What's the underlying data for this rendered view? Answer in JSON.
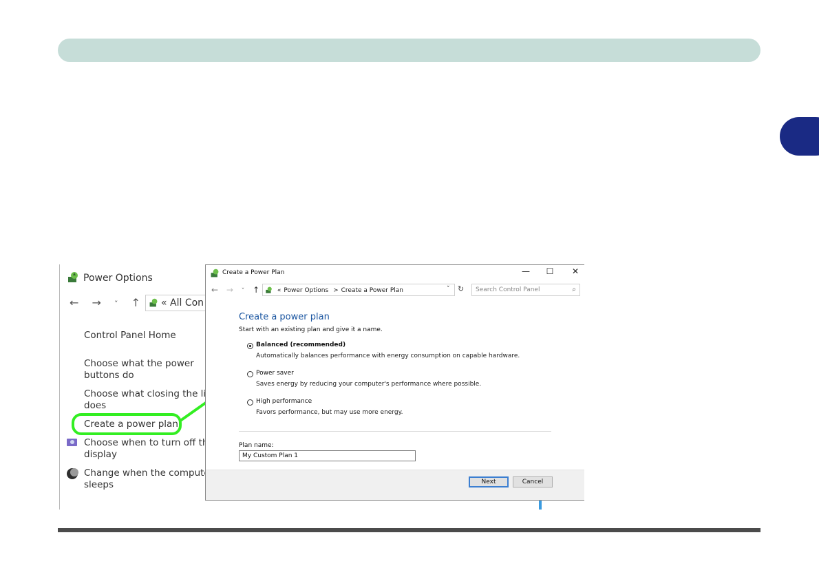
{
  "background_window": {
    "title": "Power Options",
    "nav": {
      "back": "←",
      "forward": "→",
      "recent": "˅",
      "up": "↑"
    },
    "address_text": "« All Con",
    "links": [
      {
        "label": "Control Panel Home"
      },
      {
        "label": "Choose what the power buttons do"
      },
      {
        "label": "Choose what closing the lid does"
      },
      {
        "label": "Create a power plan"
      },
      {
        "label": "Choose when to turn off the display"
      },
      {
        "label": "Change when the computer sleeps"
      }
    ]
  },
  "dialog": {
    "title": "Create a Power Plan",
    "window_controls": {
      "minimize": "—",
      "maximize": "☐",
      "close": "✕"
    },
    "nav": {
      "back": "←",
      "forward": "→",
      "recent": "˅",
      "up": "↑"
    },
    "breadcrumb": {
      "prefix": "«",
      "items": [
        "Power Options",
        "Create a Power Plan"
      ],
      "separator": ">"
    },
    "address_dropdown": "˅",
    "refresh": "↻",
    "search_placeholder": "Search Control Panel",
    "heading": "Create a power plan",
    "intro": "Start with an existing plan and give it a name.",
    "plans": [
      {
        "name": "Balanced (recommended)",
        "description": "Automatically balances performance with energy consumption on capable hardware.",
        "selected": true
      },
      {
        "name": "Power saver",
        "description": "Saves energy by reducing your computer's performance where possible.",
        "selected": false
      },
      {
        "name": "High performance",
        "description": "Favors performance, but may use more energy.",
        "selected": false
      }
    ],
    "plan_name_label": "Plan name:",
    "plan_name_value": "My Custom Plan 1",
    "buttons": {
      "next": "Next",
      "cancel": "Cancel"
    }
  },
  "colors": {
    "banner": "#c6ddd8",
    "chapter_tab": "#1a2a84",
    "highlight": "#33ee22",
    "heading_blue": "#1a55a0"
  }
}
